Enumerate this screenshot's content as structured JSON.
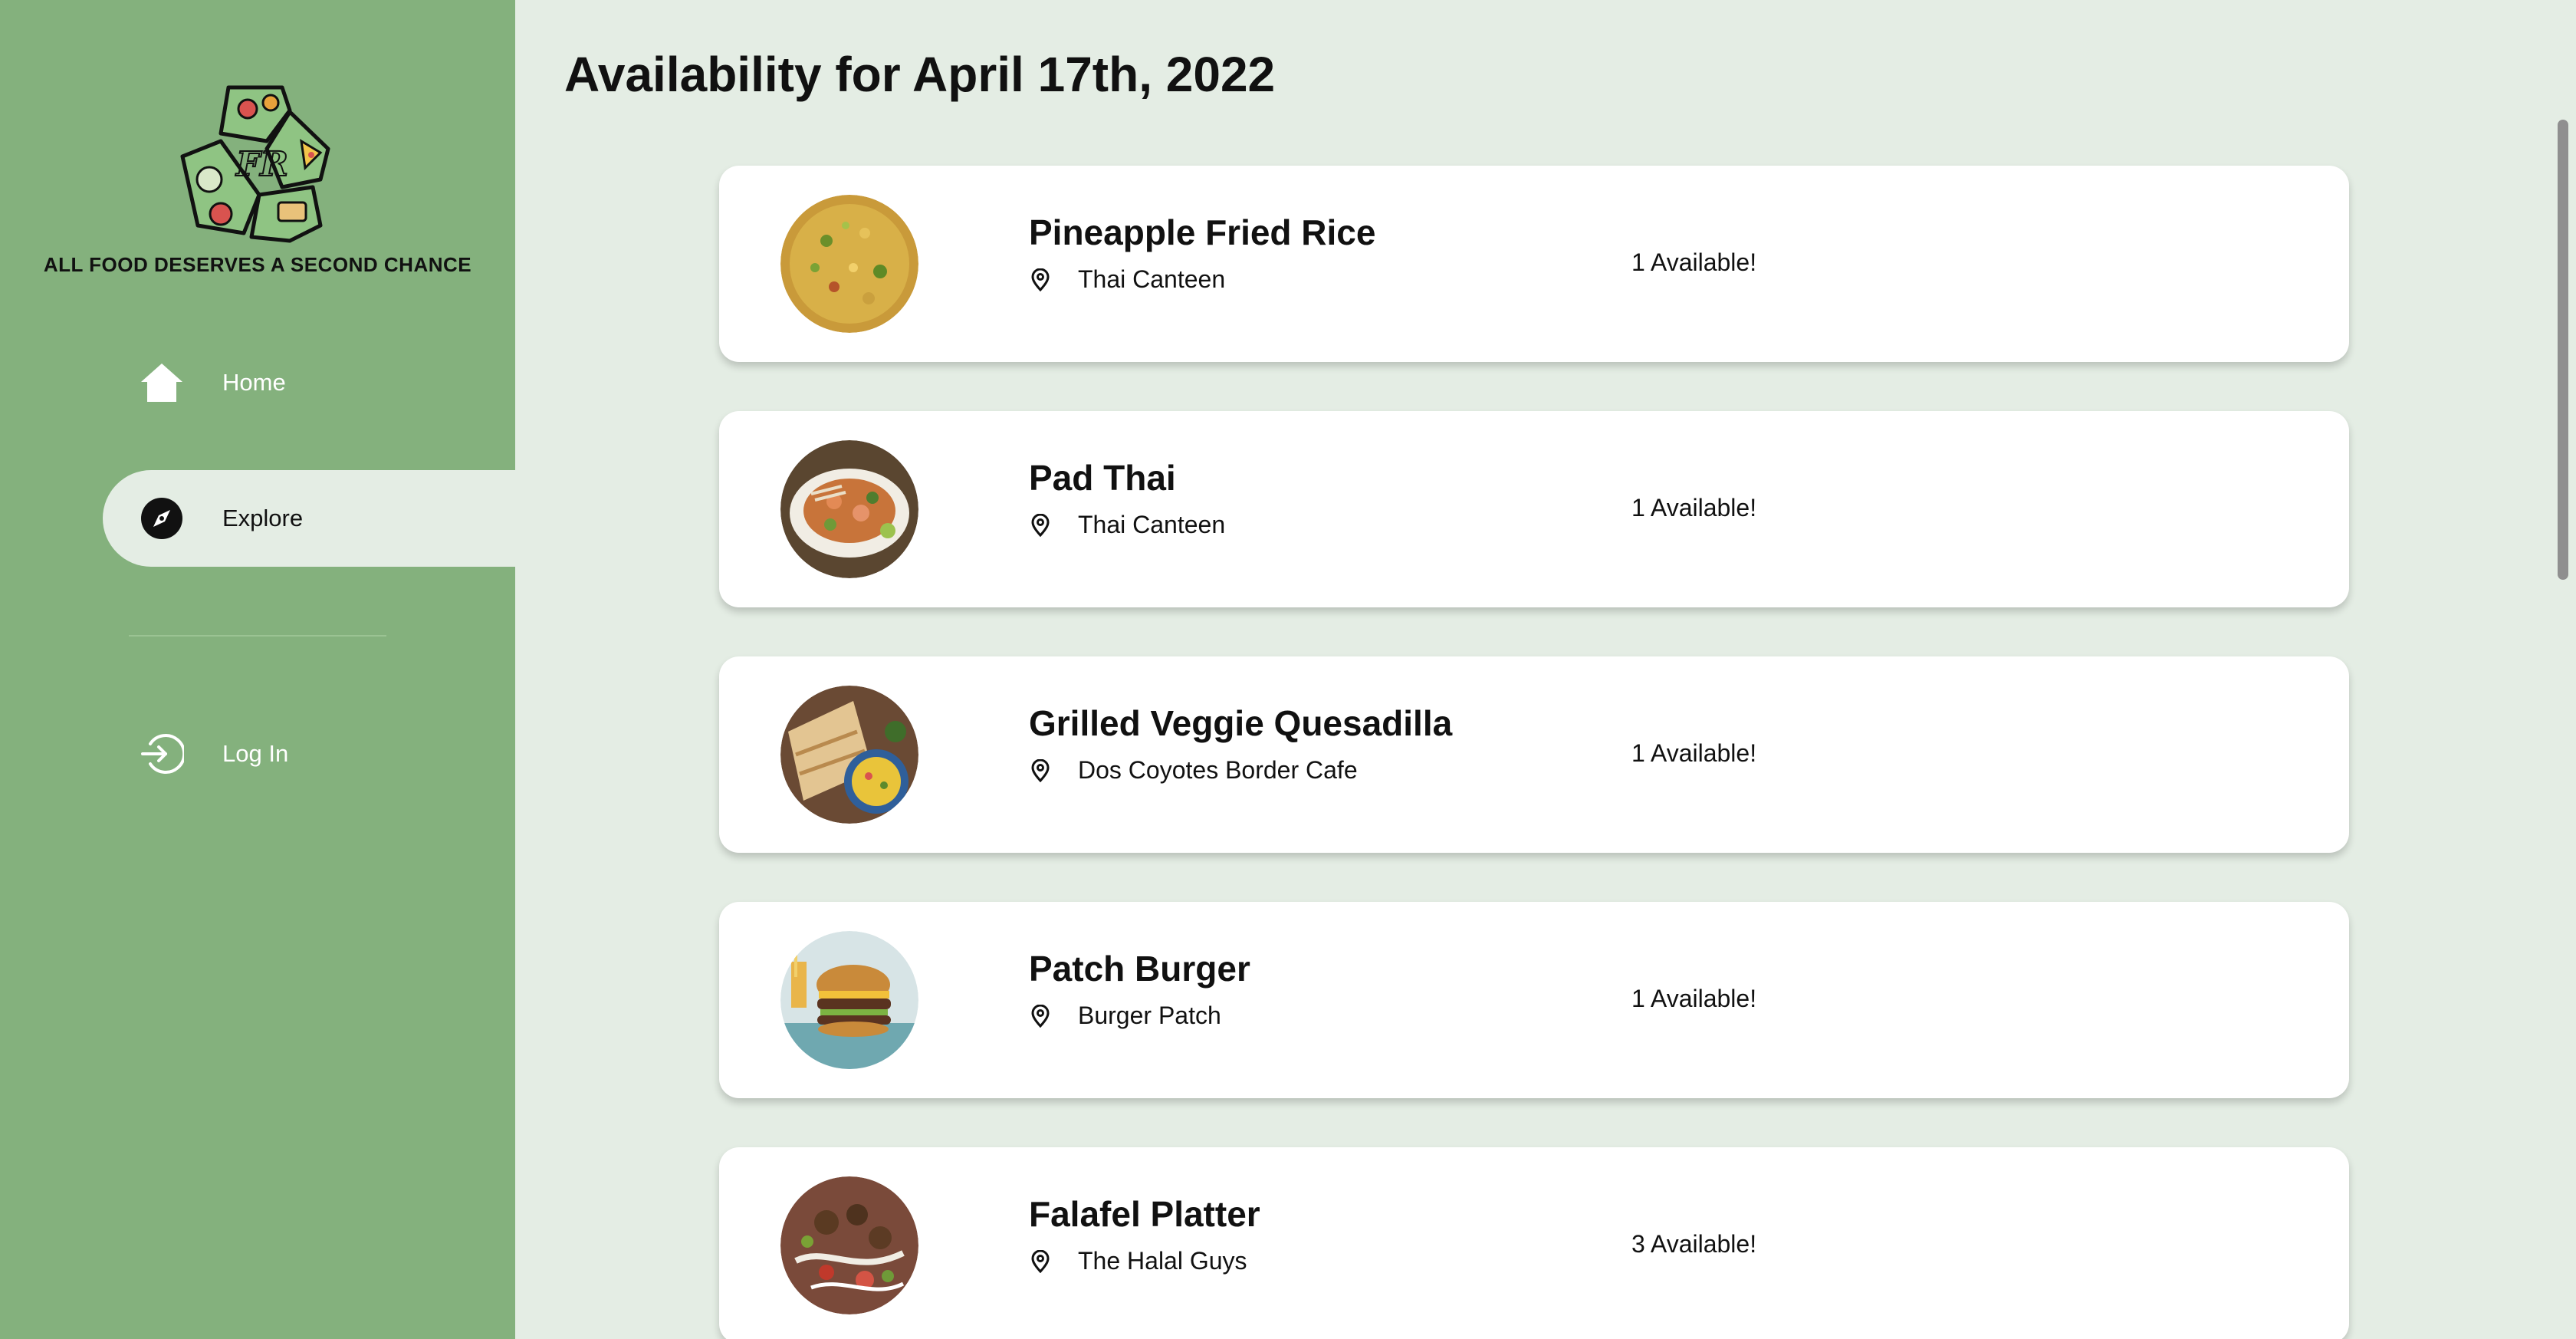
{
  "sidebar": {
    "logo_letters": "FR",
    "tagline": "ALL FOOD DESERVES A SECOND CHANCE",
    "nav": {
      "home": {
        "label": "Home",
        "icon": "home-icon"
      },
      "explore": {
        "label": "Explore",
        "icon": "compass-icon",
        "active": true
      },
      "login": {
        "label": "Log In",
        "icon": "login-icon"
      }
    }
  },
  "main": {
    "title": "Availability for April 17th, 2022",
    "items": [
      {
        "name": "Pineapple Fried Rice",
        "location": "Thai Canteen",
        "availability": "1 Available!",
        "image": "fried-rice-photo"
      },
      {
        "name": "Pad Thai",
        "location": "Thai Canteen",
        "availability": "1 Available!",
        "image": "pad-thai-photo"
      },
      {
        "name": "Grilled Veggie Quesadilla",
        "location": "Dos Coyotes Border Cafe",
        "availability": "1 Available!",
        "image": "quesadilla-photo"
      },
      {
        "name": "Patch Burger",
        "location": "Burger Patch",
        "availability": "1 Available!",
        "image": "burger-photo"
      },
      {
        "name": "Falafel Platter",
        "location": "The Halal Guys",
        "availability": "3 Available!",
        "image": "falafel-photo"
      }
    ]
  },
  "colors": {
    "sidebar_bg": "#84b17d",
    "main_bg": "#e4ede4",
    "card_bg": "#ffffff",
    "text": "#111111"
  }
}
